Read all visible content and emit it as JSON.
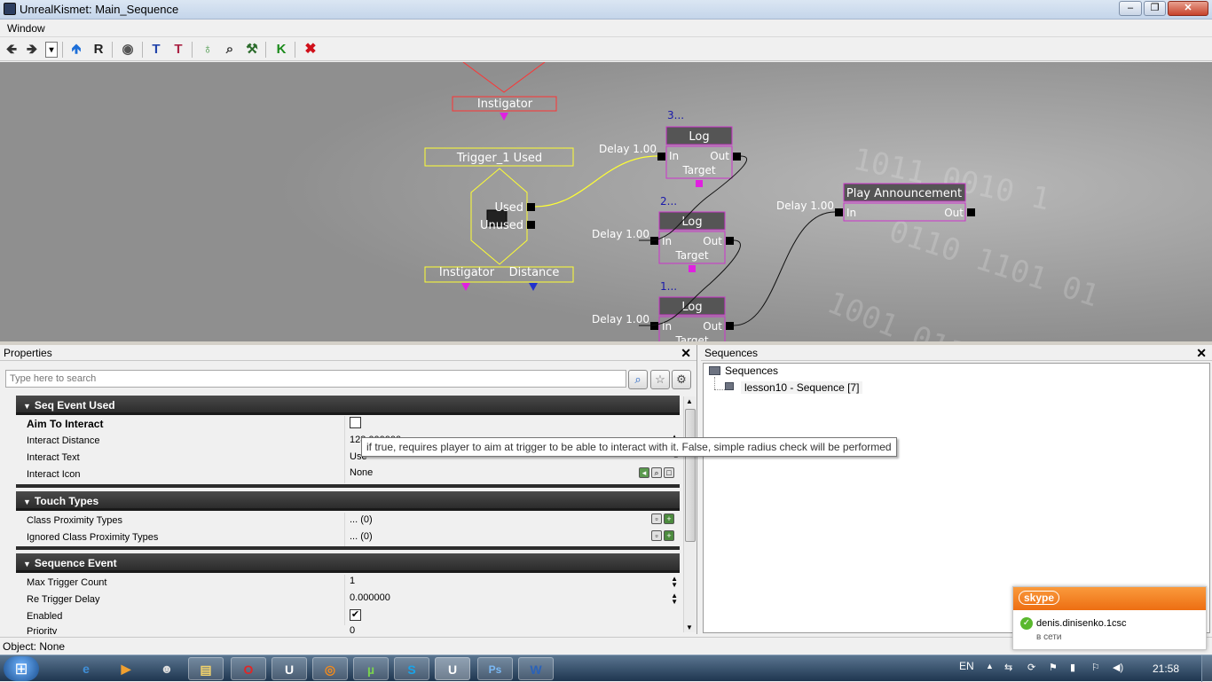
{
  "window": {
    "title": "UnrealKismet: Main_Sequence",
    "min": "–",
    "max": "❐",
    "close": "✕"
  },
  "menu": {
    "window": "Window"
  },
  "toolbar": {
    "icons": [
      "back-arrow-icon",
      "forward-arrow-icon",
      "dropdown-icon",
      "up-arrow-icon",
      "r-icon",
      "eye-icon",
      "align-top-icon",
      "align-top-red-icon",
      "bulb-icon",
      "zoom-icon",
      "hammer-icon",
      "k-icon",
      "stop-icon"
    ],
    "glyphs": {
      "back": "🡸",
      "forward": "🡺",
      "dropdown": "▾",
      "up": "🡹",
      "r": "R",
      "eye": "◉",
      "align1": "T",
      "align2": "T",
      "bulb": "♁",
      "zoom": "⌕",
      "hammer": "⚒",
      "k": "K",
      "stop": "✖"
    }
  },
  "graph": {
    "instigator_top": "Instigator",
    "event_title": "Trigger_1 Used",
    "event_out_used": "Used",
    "event_out_unused": "Unused",
    "event_var_instigator": "Instigator",
    "event_var_distance": "Distance",
    "log3": {
      "index": "3...",
      "title": "Log",
      "in": "In",
      "out": "Out",
      "target": "Target",
      "delay": "Delay 1.00"
    },
    "log2": {
      "index": "2...",
      "title": "Log",
      "in": "In",
      "out": "Out",
      "target": "Target",
      "delay": "Delay 1.00"
    },
    "log1": {
      "index": "1...",
      "title": "Log",
      "in": "In",
      "out": "Out",
      "target": "Target",
      "delay": "Delay 1.00"
    },
    "announce": {
      "title": "Play Announcement",
      "in": "In",
      "out": "Out",
      "delay": "Delay 1.00"
    }
  },
  "properties": {
    "title": "Properties",
    "close": "✕",
    "search_placeholder": "Type here to search",
    "categories": [
      {
        "name": "Seq Event Used",
        "rows": [
          {
            "label": "Aim To Interact",
            "value": "",
            "bold": true,
            "type": "checkbox",
            "checked": false
          },
          {
            "label": "Interact Distance",
            "value": "128.000000"
          },
          {
            "label": "Interact Text",
            "value": "Use"
          },
          {
            "label": "Interact Icon",
            "value": "None"
          }
        ]
      },
      {
        "name": "Touch Types",
        "rows": [
          {
            "label": "Class Proximity Types",
            "value": "... (0)"
          },
          {
            "label": "Ignored Class Proximity Types",
            "value": "... (0)"
          }
        ]
      },
      {
        "name": "Sequence Event",
        "rows": [
          {
            "label": "Max Trigger Count",
            "value": "1"
          },
          {
            "label": "Re Trigger Delay",
            "value": "0.000000"
          },
          {
            "label": "Enabled",
            "value": "",
            "type": "checkbox",
            "checked": true
          },
          {
            "label": "Priority",
            "value": "0"
          }
        ]
      }
    ],
    "tooltip": "if true, requires player to aim at trigger to be able to interact with it. False, simple radius check will be performed"
  },
  "sequences": {
    "title": "Sequences",
    "close": "✕",
    "root": "Sequences",
    "child": "lesson10 - Sequence [7]"
  },
  "status": {
    "text": "Object: None"
  },
  "skype": {
    "brand": "skype",
    "user": "denis.dinisenko.1csc",
    "status": "в сети"
  },
  "taskbar": {
    "apps": [
      {
        "name": "ie-icon",
        "glyph": "e",
        "color": "#3f8fd8"
      },
      {
        "name": "media-player-icon",
        "glyph": "▶",
        "color": "#f0a030"
      },
      {
        "name": "game-icon",
        "glyph": "☻",
        "color": "#ddd"
      },
      {
        "name": "explorer-icon",
        "glyph": "▤",
        "color": "#f3d36b"
      },
      {
        "name": "opera-icon",
        "glyph": "O",
        "color": "#e12626"
      },
      {
        "name": "unreal-icon",
        "glyph": "U",
        "color": "#fff"
      },
      {
        "name": "firefox-icon",
        "glyph": "◎",
        "color": "#f28a1c"
      },
      {
        "name": "utorrent-icon",
        "glyph": "µ",
        "color": "#7ad24f"
      },
      {
        "name": "skype-icon",
        "glyph": "S",
        "color": "#1aa3e8"
      },
      {
        "name": "unreal-editor-icon",
        "glyph": "U",
        "color": "#fff"
      },
      {
        "name": "photoshop-icon",
        "glyph": "Ps",
        "color": "#7ab9f5"
      },
      {
        "name": "word-icon",
        "glyph": "W",
        "color": "#2b62b8"
      }
    ],
    "lang": "EN",
    "clock": "21:58",
    "tray_glyphs": {
      "up": "▲",
      "network": "⇆",
      "sync": "⟳",
      "flag": "⚑",
      "signal": "▮",
      "flag2": "⚐",
      "volume": "◀)"
    }
  },
  "colors": {
    "graph_bg": "#8f8f8f",
    "event_yellow": "#ffff33",
    "node_magenta": "#cc33cc",
    "var_red": "#ff3333",
    "link_yellow": "#ffff33",
    "skype_orange": "#f58220"
  }
}
